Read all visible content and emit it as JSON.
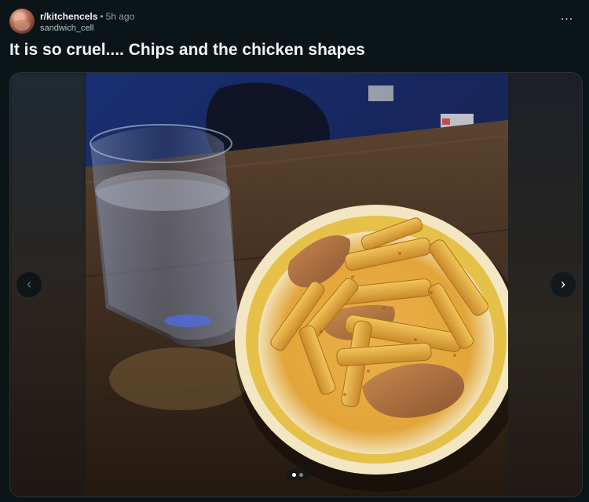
{
  "post": {
    "subreddit": "r/kitchencels",
    "separator": "•",
    "time": "5h ago",
    "author": "sandwich_cell",
    "overflow_label": "...",
    "title": "It is so cruel.... Chips and the chicken shapes"
  },
  "gallery": {
    "current": 1,
    "total": 2,
    "prev_icon": "‹",
    "next_icon": "›"
  },
  "icons": {
    "overflow": "three-dots-icon",
    "prev": "chevron-left-icon",
    "next": "chevron-right-icon"
  },
  "colors": {
    "background": "#0b1416",
    "text": "#f2f4f5",
    "muted": "#8ba2ad"
  }
}
